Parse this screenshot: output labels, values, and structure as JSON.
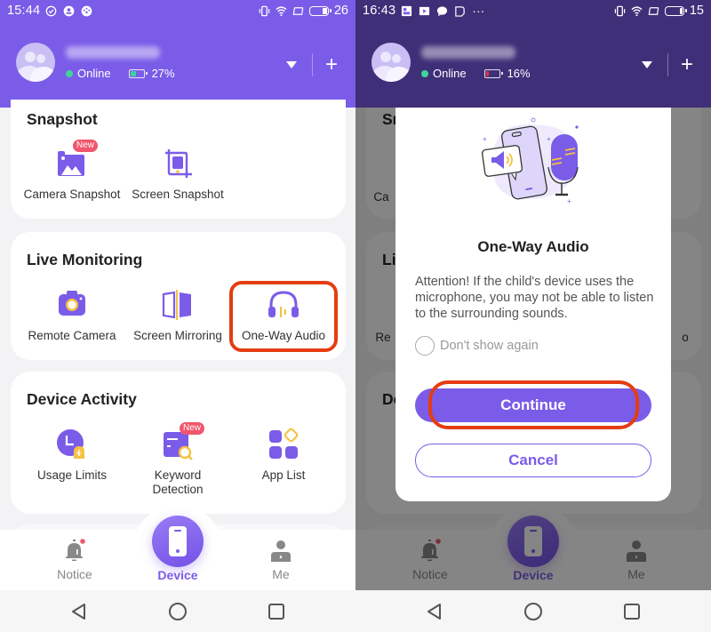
{
  "colors": {
    "brand": "#7b5ce8",
    "header_dim": "#3f2f78",
    "online": "#3ed49a",
    "badge": "#f0566c",
    "highlight": "#e43d12",
    "accent_yellow": "#f5c242"
  },
  "left": {
    "statusbar": {
      "time": "15:44",
      "left_icons": [
        "check-circle-icon",
        "account-icon",
        "speedometer-icon"
      ],
      "right_icons": [
        "vibrate-icon",
        "wifi-icon",
        "sim-icon",
        "battery-icon"
      ],
      "battery": "26"
    },
    "profile": {
      "name": "[blurred]",
      "status": "Online",
      "battery": "27%",
      "battery_fraction": 0.27
    },
    "sections": [
      {
        "title": "Snapshot",
        "items": [
          {
            "label": "Camera Snapshot",
            "icon": "camera-snapshot-icon",
            "badge": "New"
          },
          {
            "label": "Screen Snapshot",
            "icon": "screen-snapshot-icon"
          }
        ]
      },
      {
        "title": "Live Monitoring",
        "items": [
          {
            "label": "Remote Camera",
            "icon": "remote-camera-icon"
          },
          {
            "label": "Screen Mirroring",
            "icon": "screen-mirroring-icon"
          },
          {
            "label": "One-Way Audio",
            "icon": "headphones-icon",
            "highlighted": true
          }
        ]
      },
      {
        "title": "Device Activity",
        "items": [
          {
            "label": "Usage Limits",
            "icon": "usage-limits-icon"
          },
          {
            "label": "Keyword Detection",
            "label_line1": "Keyword",
            "label_line2": "Detection",
            "icon": "keyword-detection-icon",
            "badge": "New"
          },
          {
            "label": "App List",
            "icon": "app-list-icon"
          }
        ]
      }
    ],
    "nav": {
      "notice": "Notice",
      "device": "Device",
      "me": "Me",
      "active": "Device"
    }
  },
  "right": {
    "statusbar": {
      "time": "16:43",
      "left_icons": [
        "image-app-icon",
        "youtube-icon",
        "chat-icon",
        "sim-card-icon",
        "more-dots-icon"
      ],
      "right_icons": [
        "vibrate-icon",
        "wifi-icon",
        "sim-icon",
        "battery-icon"
      ],
      "battery": "15",
      "more": "···"
    },
    "profile": {
      "name": "[blurred]",
      "status": "Online",
      "battery": "16%",
      "battery_fraction": 0.16
    },
    "bg_fragments": {
      "snapshot_partial": "Sn",
      "camera_partial": "Ca",
      "live_partial": "Li",
      "remote_partial": "Re",
      "audio_partial": "o",
      "device_partial": "De"
    },
    "dialog": {
      "title": "One-Way Audio",
      "message": "Attention! If the child's device uses the microphone, you may not be able to listen to the surrounding sounds.",
      "checkbox_label": "Don't show again",
      "checkbox_checked": false,
      "continue_label": "Continue",
      "cancel_label": "Cancel",
      "continue_highlighted": true
    },
    "nav": {
      "notice": "Notice",
      "device": "Device",
      "me": "Me",
      "active": "Device"
    }
  }
}
